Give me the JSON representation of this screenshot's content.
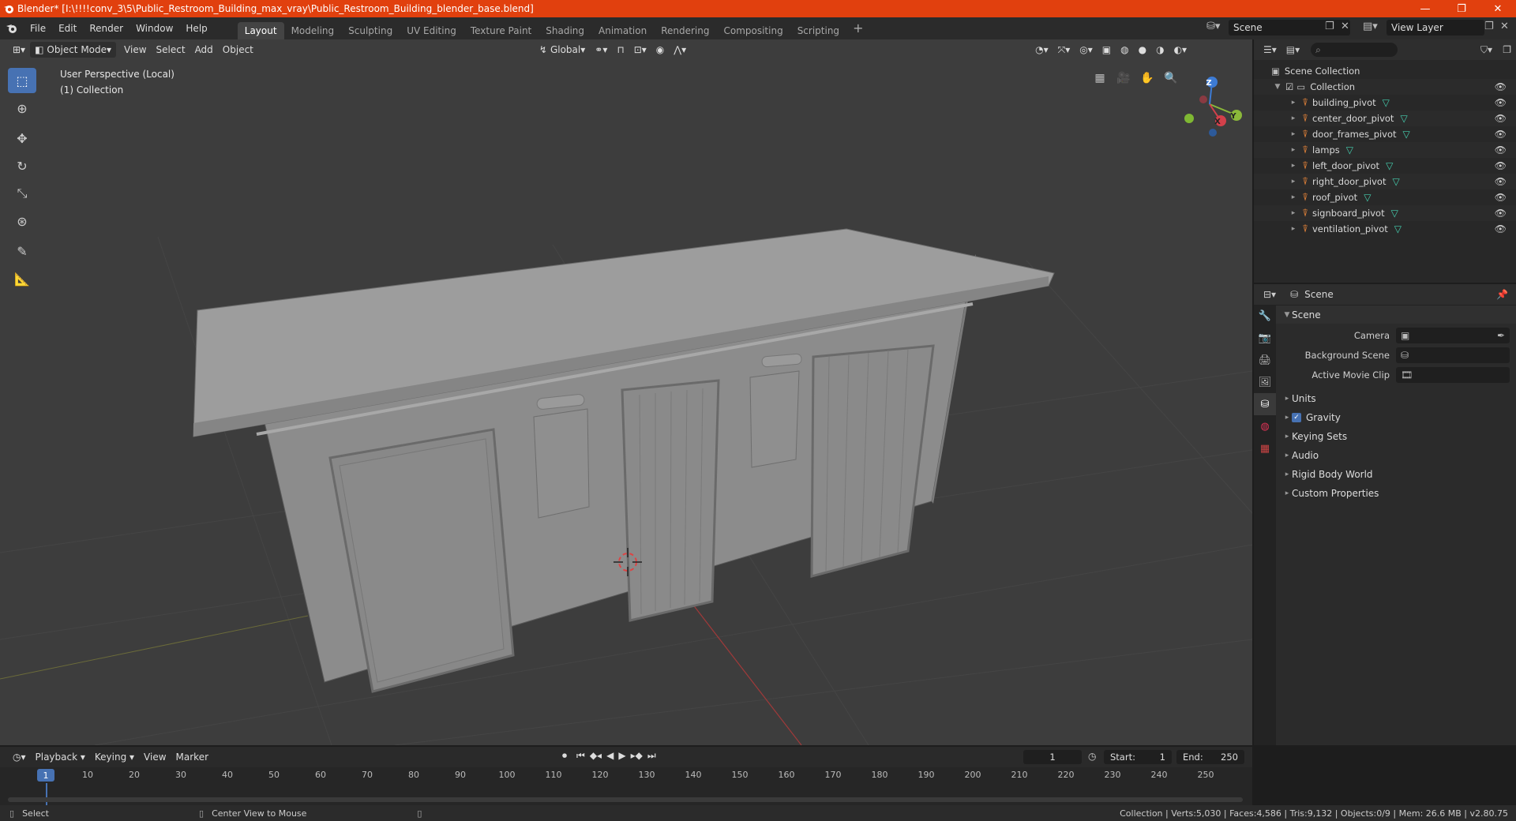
{
  "window": {
    "title": "Blender* [I:\\!!!!conv_3\\5\\Public_Restroom_Building_max_vray\\Public_Restroom_Building_blender_base.blend]",
    "controls": [
      "—",
      "❐",
      "✕"
    ]
  },
  "menu": [
    "File",
    "Edit",
    "Render",
    "Window",
    "Help"
  ],
  "workspaces": [
    "Layout",
    "Modeling",
    "Sculpting",
    "UV Editing",
    "Texture Paint",
    "Shading",
    "Animation",
    "Rendering",
    "Compositing",
    "Scripting"
  ],
  "active_workspace": "Layout",
  "scene_name": "Scene",
  "view_layer": "View Layer",
  "viewport": {
    "mode": "Object Mode",
    "menus": [
      "View",
      "Select",
      "Add",
      "Object"
    ],
    "transform_orientation": "Global",
    "info_line1": "User Perspective (Local)",
    "info_line2": "(1) Collection",
    "gizmo_axes": [
      "X",
      "Y",
      "Z"
    ]
  },
  "outliner": {
    "search_placeholder": "",
    "root": "Scene Collection",
    "collection": "Collection",
    "objects": [
      "building_pivot",
      "center_door_pivot",
      "door_frames_pivot",
      "lamps",
      "left_door_pivot",
      "right_door_pivot",
      "roof_pivot",
      "signboard_pivot",
      "ventilation_pivot"
    ]
  },
  "properties": {
    "header": "Scene",
    "section": "Scene",
    "fields": [
      {
        "label": "Camera",
        "value": ""
      },
      {
        "label": "Background Scene",
        "value": ""
      },
      {
        "label": "Active Movie Clip",
        "value": ""
      }
    ],
    "subsections": [
      "Units",
      "Gravity",
      "Keying Sets",
      "Audio",
      "Rigid Body World",
      "Custom Properties"
    ],
    "gravity_enabled": true
  },
  "timeline": {
    "menus": [
      "Playback",
      "Keying",
      "View",
      "Marker"
    ],
    "current_frame": "1",
    "start_label": "Start:",
    "start": "1",
    "end_label": "End:",
    "end": "250",
    "ticks": [
      "10",
      "20",
      "30",
      "40",
      "50",
      "60",
      "70",
      "80",
      "90",
      "100",
      "110",
      "120",
      "130",
      "140",
      "150",
      "160",
      "170",
      "180",
      "190",
      "200",
      "210",
      "220",
      "230",
      "240",
      "250"
    ]
  },
  "statusbar": {
    "left1": "Select",
    "left2": "Center View to Mouse",
    "right": "Collection | Verts:5,030 | Faces:4,586 | Tris:9,132 | Objects:0/9 | Mem: 26.6 MB | v2.80.75"
  }
}
